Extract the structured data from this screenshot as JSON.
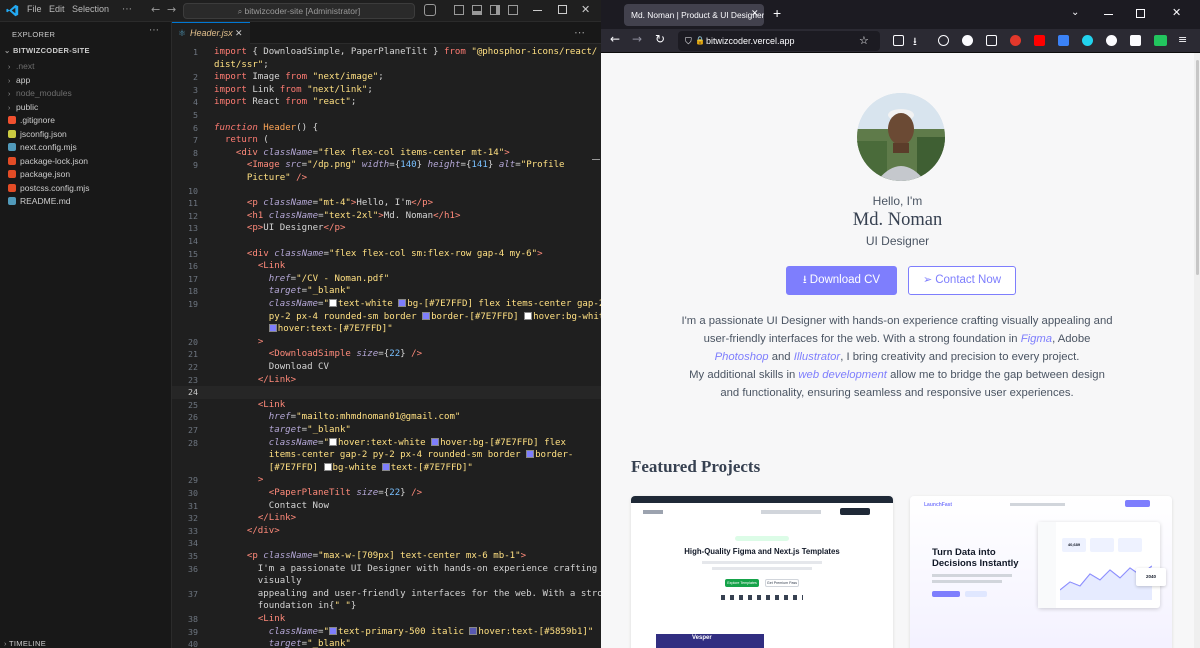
{
  "vscode": {
    "menu": [
      "File",
      "Edit",
      "Selection"
    ],
    "search": "bitwizcoder-site [Administrator]",
    "explorer_label": "EXPLORER",
    "project": "BITWIZCODER-SITE",
    "timeline_label": "TIMELINE",
    "tree": [
      {
        "name": ".next",
        "kind": "folder",
        "color": "#6e6e6e"
      },
      {
        "name": "app",
        "kind": "folder",
        "color": "#cccccc"
      },
      {
        "name": "node_modules",
        "kind": "folder",
        "color": "#6e6e6e"
      },
      {
        "name": "public",
        "kind": "folder",
        "color": "#cccccc"
      },
      {
        "name": ".gitignore",
        "kind": "file",
        "color": "#f1502f"
      },
      {
        "name": "jsconfig.json",
        "kind": "file",
        "color": "#cbcb41"
      },
      {
        "name": "next.config.mjs",
        "kind": "file",
        "color": "#519aba"
      },
      {
        "name": "package-lock.json",
        "kind": "file",
        "color": "#e34c26"
      },
      {
        "name": "package.json",
        "kind": "file",
        "color": "#e34c26"
      },
      {
        "name": "postcss.config.mjs",
        "kind": "file",
        "color": "#e34c26"
      },
      {
        "name": "README.md",
        "kind": "file",
        "color": "#519aba"
      }
    ],
    "tab_name": "Header.jsx",
    "code": [
      {
        "n": "1",
        "h": "<span class=\"kw\">import</span> { DownloadSimple, PaperPlaneTilt } <span class=\"kw\">from</span> <span class=\"str\">\"@phosphor-icons/react/</span>"
      },
      {
        "n": "",
        "h": "<span class=\"str\">dist/ssr\"</span>;"
      },
      {
        "n": "2",
        "h": "<span class=\"kw\">import</span> Image <span class=\"kw\">from</span> <span class=\"str\">\"next/image\"</span>;"
      },
      {
        "n": "3",
        "h": "<span class=\"kw\">import</span> Link <span class=\"kw\">from</span> <span class=\"str\">\"next/link\"</span>;"
      },
      {
        "n": "4",
        "h": "<span class=\"kw\">import</span> React <span class=\"kw\">from</span> <span class=\"str\">\"react\"</span>;"
      },
      {
        "n": "5",
        "h": ""
      },
      {
        "n": "6",
        "h": "<span class=\"kw it\">function</span> <span class=\"fn\">Header</span>() {"
      },
      {
        "n": "7",
        "h": "  <span class=\"kw\">return</span> ("
      },
      {
        "n": "8",
        "h": "    <span class=\"tag\">&lt;div</span> <span class=\"at\">className</span>=<span class=\"str\">\"flex flex-col items-center mt-14\"</span><span class=\"tag\">&gt;</span>"
      },
      {
        "n": "9",
        "h": "      <span class=\"tag\">&lt;Image</span> <span class=\"at\">src</span>=<span class=\"str\">\"/dp.png\"</span> <span class=\"at\">width</span>={<span class=\"num\">140</span>} <span class=\"at\">height</span>={<span class=\"num\">141</span>} <span class=\"at\">alt</span>=<span class=\"str\">\"Profile</span>"
      },
      {
        "n": "",
        "h": "      <span class=\"str\">Picture\"</span> <span class=\"tag\">/&gt;</span>"
      },
      {
        "n": "10",
        "h": ""
      },
      {
        "n": "11",
        "h": "      <span class=\"tag\">&lt;p</span> <span class=\"at\">className</span>=<span class=\"str\">\"mt-4\"</span><span class=\"tag\">&gt;</span>Hello, I'm<span class=\"tag\">&lt;/p&gt;</span>"
      },
      {
        "n": "12",
        "h": "      <span class=\"tag\">&lt;h1</span> <span class=\"at\">className</span>=<span class=\"str\">\"text-2xl\"</span><span class=\"tag\">&gt;</span>Md. Noman<span class=\"tag\">&lt;/h1&gt;</span>"
      },
      {
        "n": "13",
        "h": "      <span class=\"tag\">&lt;p&gt;</span>UI Designer<span class=\"tag\">&lt;/p&gt;</span>"
      },
      {
        "n": "14",
        "h": ""
      },
      {
        "n": "15",
        "h": "      <span class=\"tag\">&lt;div</span> <span class=\"at\">className</span>=<span class=\"str\">\"flex flex-col sm:flex-row gap-4 my-6\"</span><span class=\"tag\">&gt;</span>"
      },
      {
        "n": "16",
        "h": "        <span class=\"tag\">&lt;Link</span>"
      },
      {
        "n": "17",
        "h": "          <span class=\"at\">href</span>=<span class=\"str\">\"/CV - Noman.pdf\"</span>"
      },
      {
        "n": "18",
        "h": "          <span class=\"at\">target</span>=<span class=\"str\">\"_blank\"</span>"
      },
      {
        "n": "19",
        "h": "          <span class=\"at\">className</span>=<span class=\"str\">\"<i class=\"sw\" style=\"background:#fff\"></i>text-white <i class=\"sw\" style=\"background:#7e7efd\"></i>bg-[#7E7FFD] flex items-center gap-2</span>"
      },
      {
        "n": "",
        "h": "          <span class=\"str\">py-2 px-4 rounded-sm border <i class=\"sw\" style=\"background:#7e7efd\"></i>border-[#7E7FFD] <i class=\"sw\" style=\"background:#fff\"></i>hover:bg-white</span>"
      },
      {
        "n": "",
        "h": "          <span class=\"str\"><i class=\"sw\" style=\"background:#7e7efd\"></i>hover:text-[#7E7FFD]\"</span>"
      },
      {
        "n": "20",
        "h": "        <span class=\"tag\">&gt;</span>"
      },
      {
        "n": "21",
        "h": "          <span class=\"tag\">&lt;DownloadSimple</span> <span class=\"at\">size</span>={<span class=\"num\">22</span>} <span class=\"tag\">/&gt;</span>"
      },
      {
        "n": "22",
        "h": "          Download CV"
      },
      {
        "n": "23",
        "h": "        <span class=\"tag\">&lt;/Link&gt;</span>"
      },
      {
        "n": "24",
        "h": "",
        "cur": true
      },
      {
        "n": "25",
        "h": "        <span class=\"tag\">&lt;Link</span>"
      },
      {
        "n": "26",
        "h": "          <span class=\"at\">href</span>=<span class=\"str\">\"mailto:mhmdnoman01@gmail.com\"</span>"
      },
      {
        "n": "27",
        "h": "          <span class=\"at\">target</span>=<span class=\"str\">\"_blank\"</span>"
      },
      {
        "n": "28",
        "h": "          <span class=\"at\">className</span>=<span class=\"str\">\"<i class=\"sw\" style=\"background:#fff\"></i>hover:text-white <i class=\"sw\" style=\"background:#7e7efd\"></i>hover:bg-[#7E7FFD] flex</span>"
      },
      {
        "n": "",
        "h": "          <span class=\"str\">items-center gap-2 py-2 px-4 rounded-sm border <i class=\"sw\" style=\"background:#7e7efd\"></i>border-</span>"
      },
      {
        "n": "",
        "h": "          <span class=\"str\">[#7E7FFD] <i class=\"sw\" style=\"background:#fff\"></i>bg-white <i class=\"sw\" style=\"background:#7e7efd\"></i>text-[#7E7FFD]\"</span>"
      },
      {
        "n": "29",
        "h": "        <span class=\"tag\">&gt;</span>"
      },
      {
        "n": "30",
        "h": "          <span class=\"tag\">&lt;PaperPlaneTilt</span> <span class=\"at\">size</span>={<span class=\"num\">22</span>} <span class=\"tag\">/&gt;</span>"
      },
      {
        "n": "31",
        "h": "          Contact Now"
      },
      {
        "n": "32",
        "h": "        <span class=\"tag\">&lt;/Link&gt;</span>"
      },
      {
        "n": "33",
        "h": "      <span class=\"tag\">&lt;/div&gt;</span>"
      },
      {
        "n": "34",
        "h": ""
      },
      {
        "n": "35",
        "h": "      <span class=\"tag\">&lt;p</span> <span class=\"at\">className</span>=<span class=\"str\">\"max-w-[709px] text-center mx-6 mb-1\"</span><span class=\"tag\">&gt;</span>"
      },
      {
        "n": "36",
        "h": "        I'm a passionate UI Designer with hands-on experience crafting"
      },
      {
        "n": "",
        "h": "        visually"
      },
      {
        "n": "37",
        "h": "        appealing and user-friendly interfaces for the web. With a strong"
      },
      {
        "n": "",
        "h": "        foundation in{<span class=\"str\">\" \"</span>}"
      },
      {
        "n": "38",
        "h": "        <span class=\"tag\">&lt;Link</span>"
      },
      {
        "n": "39",
        "h": "          <span class=\"at\">className</span>=<span class=\"str\">\"<i class=\"sw\" style=\"background:#7e7efd\"></i>text-primary-500 italic <i class=\"sw\" style=\"background:#5859b1\"></i>hover:text-[#5859b1]\"</span>"
      },
      {
        "n": "40",
        "h": "          <span class=\"at\">target</span>=<span class=\"str\">\"_blank\"</span>"
      }
    ]
  },
  "browser": {
    "tab_title": "Md. Noman | Product & UI Designer",
    "new_tab": "+",
    "url": "bitwizcoder.vercel.app",
    "hello": "Hello, I'm",
    "name": "Md. Noman",
    "role": "UI Designer",
    "download_btn": "Download CV",
    "contact_btn": "Contact Now",
    "accent": "#7E7FFD",
    "para1": {
      "a": "I'm a passionate UI Designer with hands-on experience crafting visually appealing and",
      "b": "user-friendly interfaces for the web. With a strong foundation in ",
      "figma": "Figma",
      "c": ", Adobe",
      "photoshop": "Photoshop",
      "and": " and ",
      "illustrator": "Illustrator",
      "d": ", I bring creativity and precision to every project."
    },
    "para2": {
      "a": "My additional skills in ",
      "webdev": "web development",
      "b": " allow me to bridge the gap between design",
      "c": "and functionality, ensuring seamless and responsive user experiences."
    },
    "featured_title": "Featured Projects",
    "project1": {
      "heading": "High-Quality Figma and Next.js Templates",
      "cta": "Explore Templates",
      "secondary": "Get Premium Pass",
      "badge": "Vesper"
    },
    "project2": {
      "logo": "LaunchFast",
      "heading_line1": "Turn Data into",
      "heading_line2": "Decisions Instantly",
      "stat1": "40,689",
      "stat2": "2040"
    }
  }
}
